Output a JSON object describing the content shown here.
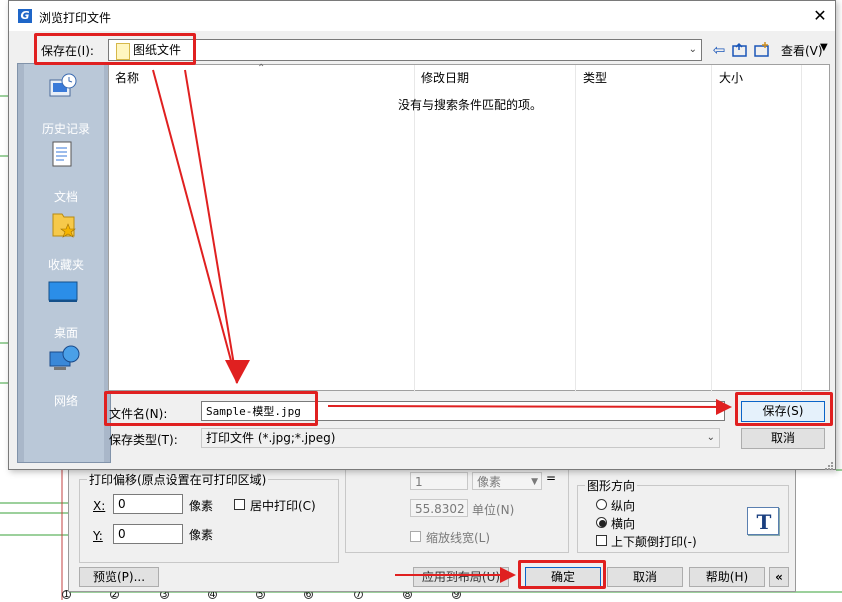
{
  "dialog": {
    "title": "浏览打印文件",
    "save_in_label": "保存在(I):",
    "save_in_value": "图纸文件",
    "view_label": "查看(V)",
    "places": [
      "历史记录",
      "文档",
      "收藏夹",
      "桌面",
      "网络"
    ],
    "columns": [
      "名称",
      "修改日期",
      "类型",
      "大小"
    ],
    "empty_message": "没有与搜索条件匹配的项。",
    "filename_label": "文件名(N):",
    "filename_value": "Sample-模型.jpg",
    "filetype_label": "保存类型(T):",
    "filetype_value": "打印文件 (*.jpg;*.jpeg)",
    "save_button": "保存(S)",
    "cancel_button": "取消"
  },
  "print_dialog": {
    "offset_group": "打印偏移(原点设置在可打印区域)",
    "x_label": "X:",
    "x_value": "0",
    "y_label": "Y:",
    "y_value": "0",
    "unit_px": "像素",
    "center_print": "居中打印(C)",
    "scale_value": "1",
    "scale_unit": "像素",
    "equals": "=",
    "unit_value": "55.8302",
    "unit_label": "单位(N)",
    "scale_lineweight": "缩放线宽(L)",
    "orientation_group": "图形方向",
    "portrait": "纵向",
    "landscape": "横向",
    "upside_down": "上下颠倒打印(-)",
    "orientation_icon_letter": "T",
    "preview_button": "预览(P)...",
    "apply_layout_button": "应用到布局(U)",
    "ok_button": "确定",
    "cancel_button": "取消",
    "help_button": "帮助(H)",
    "collapse_button": "«"
  },
  "bottom_numbers": [
    "1",
    "2",
    "3",
    "4",
    "5",
    "6",
    "7",
    "8",
    "9"
  ],
  "colors": {
    "highlight_red": "#e02020",
    "places_bg": "#bac8d8",
    "accent_blue": "#0a64c8"
  }
}
